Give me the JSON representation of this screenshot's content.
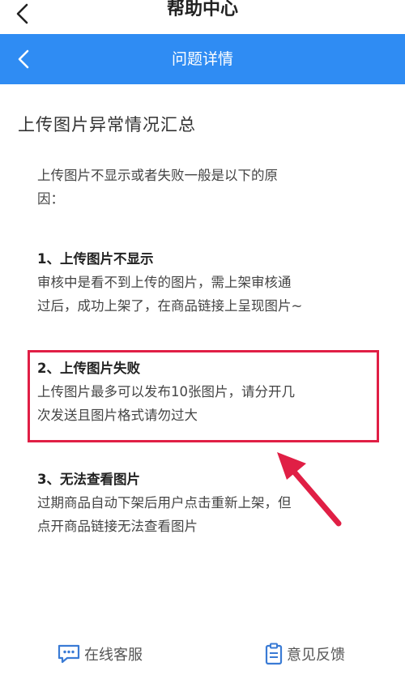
{
  "header": {
    "title": "帮助中心"
  },
  "nav": {
    "title": "问题详情"
  },
  "article": {
    "title": "上传图片异常情况汇总",
    "intro_lines": [
      "上传图片不显示或者失败一般是以下的原",
      "因："
    ],
    "sections": [
      {
        "heading": "1、上传图片不显示",
        "lines": [
          "审核中是看不到上传的图片，需上架审核通",
          "过后，成功上架了，在商品链接上呈现图片~"
        ]
      },
      {
        "heading": "2、上传图片失败",
        "lines": [
          "上传图片最多可以发布10张图片，请分开几",
          "次发送且图片格式请勿过大"
        ]
      },
      {
        "heading": "3、无法查看图片",
        "lines": [
          "过期商品自动下架后用户点击重新上架，但",
          "点开商品链接无法查看图片"
        ]
      }
    ]
  },
  "footer": {
    "service_label": "在线客服",
    "feedback_label": "意见反馈"
  },
  "colors": {
    "nav_blue": "#2f8cf3",
    "highlight_red": "#e01f45",
    "icon_blue": "#3a7bd5"
  }
}
